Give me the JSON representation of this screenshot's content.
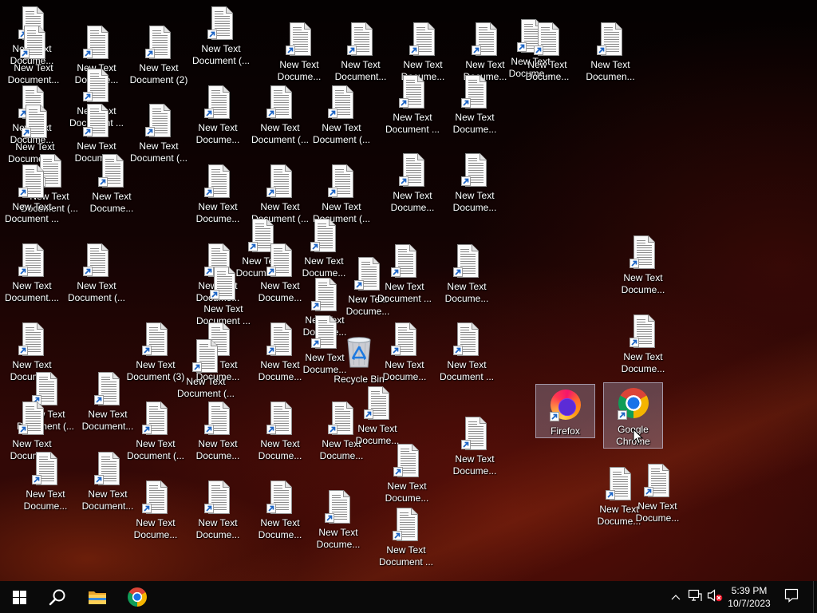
{
  "desktop": {
    "document_icon": "text-document-icon",
    "shortcut_overlay_icon": "shortcut-arrow-icon",
    "documents": [
      {
        "lines": [
          "New Text",
          "Docume..."
        ]
      },
      {
        "lines": [
          "New Text",
          "Document..."
        ]
      },
      {
        "lines": [
          "New Text",
          "Docume..."
        ]
      },
      {
        "lines": [
          "New Text",
          "Document (2)"
        ]
      },
      {
        "lines": [
          "New Text",
          "Document (..."
        ]
      },
      {
        "lines": [
          "New Text",
          "Docume..."
        ]
      },
      {
        "lines": [
          "New Text",
          "Document..."
        ]
      },
      {
        "lines": [
          "New Text",
          "Docume..."
        ]
      },
      {
        "lines": [
          "New Text",
          "Docume..."
        ]
      },
      {
        "lines": [
          "New Text",
          "Docume..."
        ]
      },
      {
        "lines": [
          "New Text",
          "Docume..."
        ]
      },
      {
        "lines": [
          "New Text",
          "Documen..."
        ]
      },
      {
        "lines": [
          "New Text",
          "Document ..."
        ]
      },
      {
        "lines": [
          "New Text",
          "Docume..."
        ]
      },
      {
        "lines": [
          "New Text",
          "Document ..."
        ]
      },
      {
        "lines": [
          "New Text",
          "Docume..."
        ]
      },
      {
        "lines": [
          "New Text",
          "Document (..."
        ]
      },
      {
        "lines": [
          "New Text",
          "Docume..."
        ]
      },
      {
        "lines": [
          "New Text",
          "Document (..."
        ]
      },
      {
        "lines": [
          "New Text",
          "Document (..."
        ]
      },
      {
        "lines": [
          "New Text",
          "Document ..."
        ]
      },
      {
        "lines": [
          "New Text",
          "Docume..."
        ]
      },
      {
        "lines": [
          "New Text",
          "Document (..."
        ]
      },
      {
        "lines": [
          "New Text",
          "Document ..."
        ]
      },
      {
        "lines": [
          "New Text",
          "Docume..."
        ]
      },
      {
        "lines": [
          "New Text",
          "Docume..."
        ]
      },
      {
        "lines": [
          "New Text",
          "Document (..."
        ]
      },
      {
        "lines": [
          "New Text",
          "Document (..."
        ]
      },
      {
        "lines": [
          "New Text",
          "Docume..."
        ]
      },
      {
        "lines": [
          "New Text",
          "Docume..."
        ]
      },
      {
        "lines": [
          "New Text",
          "Document..."
        ]
      },
      {
        "lines": [
          "New Text",
          "Docume..."
        ]
      },
      {
        "lines": [
          "New Text",
          "Document...."
        ]
      },
      {
        "lines": [
          "New Text",
          "Document (..."
        ]
      },
      {
        "lines": [
          "New Text",
          "Docume..."
        ]
      },
      {
        "lines": [
          "New Text",
          "Document ..."
        ]
      },
      {
        "lines": [
          "New Text",
          "Docume..."
        ]
      },
      {
        "lines": [
          "New Text",
          "Docume..."
        ]
      },
      {
        "lines": [
          "New Text",
          "Docume..."
        ]
      },
      {
        "lines": [
          "New Text",
          "Document ..."
        ]
      },
      {
        "lines": [
          "New Text",
          "Docume..."
        ]
      },
      {
        "lines": [
          "New Text",
          "Docume..."
        ]
      },
      {
        "lines": [
          "New Text",
          "Docume..."
        ]
      },
      {
        "lines": [
          "New Text",
          "Document (3)"
        ]
      },
      {
        "lines": [
          "New Text",
          "Docume..."
        ]
      },
      {
        "lines": [
          "New Text",
          "Document (..."
        ]
      },
      {
        "lines": [
          "New Text",
          "Docume..."
        ]
      },
      {
        "lines": [
          "New Text",
          "Docume..."
        ]
      },
      {
        "lines": [
          "New Text",
          "Docume..."
        ]
      },
      {
        "lines": [
          "New Text",
          "Document ..."
        ]
      },
      {
        "lines": [
          "New Text",
          "Docume..."
        ]
      },
      {
        "lines": [
          "New Text",
          "Document (..."
        ]
      },
      {
        "lines": [
          "New Text",
          "Document..."
        ]
      },
      {
        "lines": [
          "New Text",
          "Docume..."
        ]
      },
      {
        "lines": [
          "New Text",
          "Document (..."
        ]
      },
      {
        "lines": [
          "New Text",
          "Docume..."
        ]
      },
      {
        "lines": [
          "New Text",
          "Docume..."
        ]
      },
      {
        "lines": [
          "New Text",
          "Docume..."
        ]
      },
      {
        "lines": [
          "New Text",
          "Docume..."
        ]
      },
      {
        "lines": [
          "New Text",
          "Docume..."
        ]
      },
      {
        "lines": [
          "New Text",
          "Docume..."
        ]
      },
      {
        "lines": [
          "New Text",
          "Docume..."
        ]
      },
      {
        "lines": [
          "New Text",
          "Document..."
        ]
      },
      {
        "lines": [
          "New Text",
          "Docume..."
        ]
      },
      {
        "lines": [
          "New Text",
          "Docume..."
        ]
      },
      {
        "lines": [
          "New Text",
          "Docume..."
        ]
      },
      {
        "lines": [
          "New Text",
          "Docume..."
        ]
      },
      {
        "lines": [
          "New Text",
          "Document ..."
        ]
      },
      {
        "lines": [
          "New Text",
          "Docume..."
        ]
      },
      {
        "lines": [
          "New Text",
          "Docume..."
        ]
      }
    ],
    "recycle_bin": {
      "label": "Recycle Bin",
      "icon": "recycle-bin-icon"
    },
    "shortcuts": [
      {
        "lines": [
          "Firefox"
        ],
        "icon": "firefox-icon",
        "selected": true
      },
      {
        "lines": [
          "Google",
          "Chrome"
        ],
        "icon": "chrome-icon",
        "selected": true
      }
    ]
  },
  "taskbar": {
    "pinned": [
      "windows-start-icon",
      "search-icon",
      "file-explorer-icon",
      "chrome-icon"
    ],
    "tray": {
      "icons": [
        "chevron-up-icon",
        "network-icon",
        "volume-muted-icon",
        "notification-icon"
      ],
      "time": "5:39 PM",
      "date": "10/7/2023"
    }
  },
  "colors": {
    "taskbar": "#0a0a0a",
    "label_text": "#ffffff",
    "wallpaper_glow": "#a0320f",
    "selection": "#b9c3e6"
  }
}
